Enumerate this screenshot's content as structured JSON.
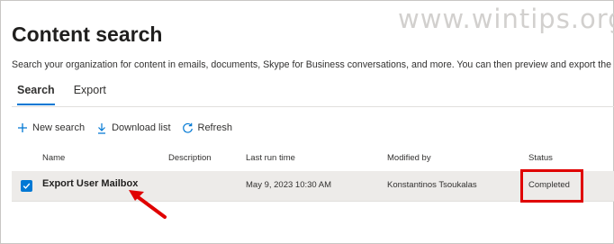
{
  "watermark": "www.wintips.org",
  "page": {
    "title": "Content search",
    "description": "Search your organization for content in emails, documents, Skype for Business conversations, and more. You can then preview and export the search result"
  },
  "tabs": [
    {
      "label": "Search",
      "active": true
    },
    {
      "label": "Export",
      "active": false
    }
  ],
  "toolbar": {
    "new_search": {
      "label": "New search",
      "icon": "plus-icon"
    },
    "download_list": {
      "label": "Download list",
      "icon": "download-icon"
    },
    "refresh": {
      "label": "Refresh",
      "icon": "refresh-icon"
    }
  },
  "table": {
    "columns": [
      "Name",
      "Description",
      "Last run time",
      "Modified by",
      "Status"
    ],
    "rows": [
      {
        "selected": true,
        "name": "Export User Mailbox",
        "description": "",
        "last_run_time": "May 9, 2023 10:30 AM",
        "modified_by": "Konstantinos Tsoukalas",
        "status": "Completed"
      }
    ]
  },
  "colors": {
    "accent": "#0078d4",
    "highlight": "#e00000",
    "row_selected_bg": "#edebe9"
  }
}
